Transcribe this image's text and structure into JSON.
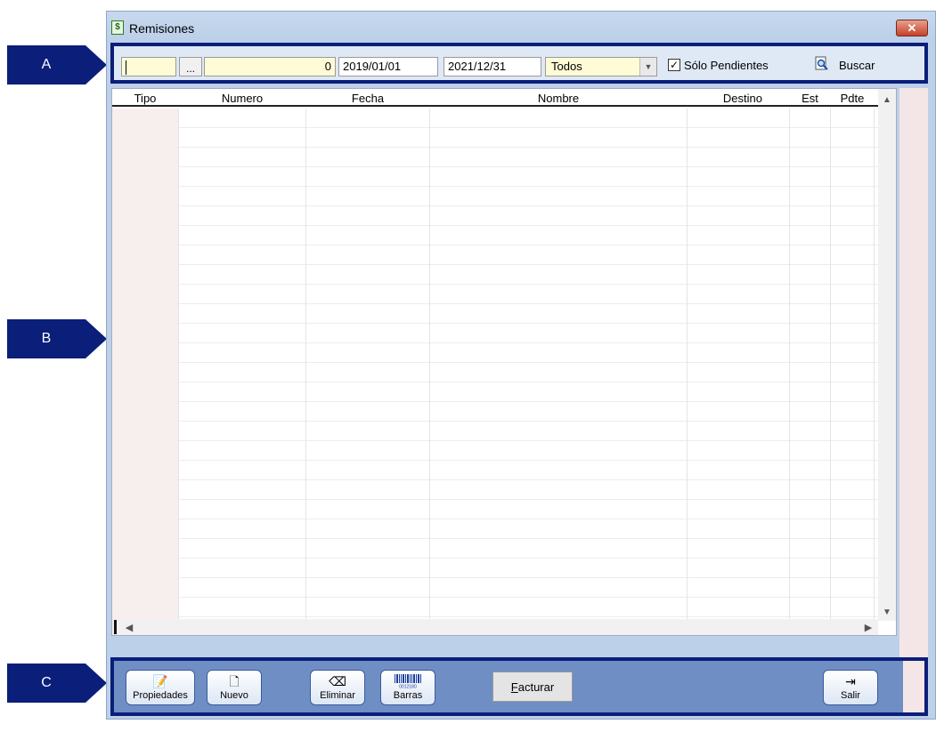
{
  "callouts": [
    {
      "label": "A"
    },
    {
      "label": "B"
    },
    {
      "label": "C"
    }
  ],
  "window": {
    "title": "Remisiones",
    "close_glyph": "✕",
    "icon": "document-dollar-icon"
  },
  "filters": {
    "code_value": "",
    "ellipsis_label": "...",
    "number_value": "0",
    "date_from": "2019/01/01",
    "date_to": "2021/12/31",
    "status_selected": "Todos",
    "only_pending_checked": true,
    "only_pending_label": "Sólo Pendientes",
    "search_label": "Buscar"
  },
  "grid": {
    "columns": [
      "Tipo",
      "Numero",
      "Fecha",
      "Nombre",
      "Destino",
      "Est",
      "Pdte"
    ],
    "rows": []
  },
  "toolbar": {
    "propiedades_label": "Propiedades",
    "nuevo_label": "Nuevo",
    "eliminar_label": "Eliminar",
    "barras_label": "Barras",
    "barras_code": "0012180",
    "facturar_hotkey": "F",
    "facturar_rest": "acturar",
    "salir_label": "Salir"
  },
  "colors": {
    "callout": "#0a1e7a",
    "field_bg": "#fffbd6",
    "toolbar_bg": "#6f8fc4"
  }
}
